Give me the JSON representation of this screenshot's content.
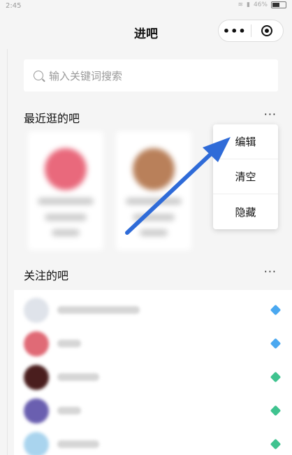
{
  "status_bar": {
    "time": "2:45",
    "battery": "46%"
  },
  "nav": {
    "title": "进吧",
    "more_icon": "more-dots-icon",
    "close_icon": "target-icon"
  },
  "search": {
    "placeholder": "输入关键词搜索"
  },
  "recent_section": {
    "title": "最近逛的吧"
  },
  "follow_section": {
    "title": "关注的吧"
  },
  "popup_menu": {
    "items": [
      {
        "label": "编辑"
      },
      {
        "label": "清空"
      },
      {
        "label": "隐藏"
      }
    ]
  },
  "colors": {
    "arrow": "#2f6bd8",
    "gem_blue": "#4aa8f0",
    "gem_green": "#3fc38f"
  }
}
